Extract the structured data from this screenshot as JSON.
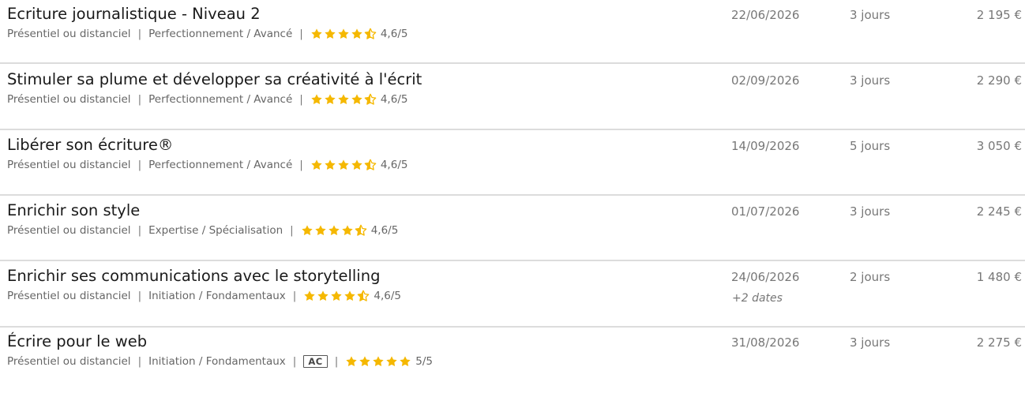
{
  "colors": {
    "star": "#f5b800",
    "divider": "#dcdcdc",
    "muted": "#777777"
  },
  "separator": "|",
  "courses": [
    {
      "title": "Ecriture journalistique - Niveau 2",
      "mode": "Présentiel ou distanciel",
      "level": "Perfectionnement / Avancé",
      "badge": null,
      "stars": 4.5,
      "rating": "4,6/5",
      "date": "22/06/2026",
      "more_dates": null,
      "duration": "3 jours",
      "price": "2 195 €"
    },
    {
      "title": "Stimuler sa plume et développer sa créativité à l'écrit",
      "mode": "Présentiel ou distanciel",
      "level": "Perfectionnement / Avancé",
      "badge": null,
      "stars": 4.5,
      "rating": "4,6/5",
      "date": "02/09/2026",
      "more_dates": null,
      "duration": "3 jours",
      "price": "2 290 €"
    },
    {
      "title": "Libérer son écriture®",
      "mode": "Présentiel ou distanciel",
      "level": "Perfectionnement / Avancé",
      "badge": null,
      "stars": 4.5,
      "rating": "4,6/5",
      "date": "14/09/2026",
      "more_dates": null,
      "duration": "5 jours",
      "price": "3 050 €"
    },
    {
      "title": "Enrichir son style",
      "mode": "Présentiel ou distanciel",
      "level": "Expertise / Spécialisation",
      "badge": null,
      "stars": 4.5,
      "rating": "4,6/5",
      "date": "01/07/2026",
      "more_dates": null,
      "duration": "3 jours",
      "price": "2 245 €"
    },
    {
      "title": "Enrichir ses communications avec le storytelling",
      "mode": "Présentiel ou distanciel",
      "level": "Initiation / Fondamentaux",
      "badge": null,
      "stars": 4.5,
      "rating": "4,6/5",
      "date": "24/06/2026",
      "more_dates": "+2 dates",
      "duration": "2 jours",
      "price": "1 480 €"
    },
    {
      "title": "Écrire pour le web",
      "mode": "Présentiel ou distanciel",
      "level": "Initiation / Fondamentaux",
      "badge": "AC",
      "stars": 5,
      "rating": "5/5",
      "date": "31/08/2026",
      "more_dates": null,
      "duration": "3 jours",
      "price": "2 275 €"
    }
  ]
}
